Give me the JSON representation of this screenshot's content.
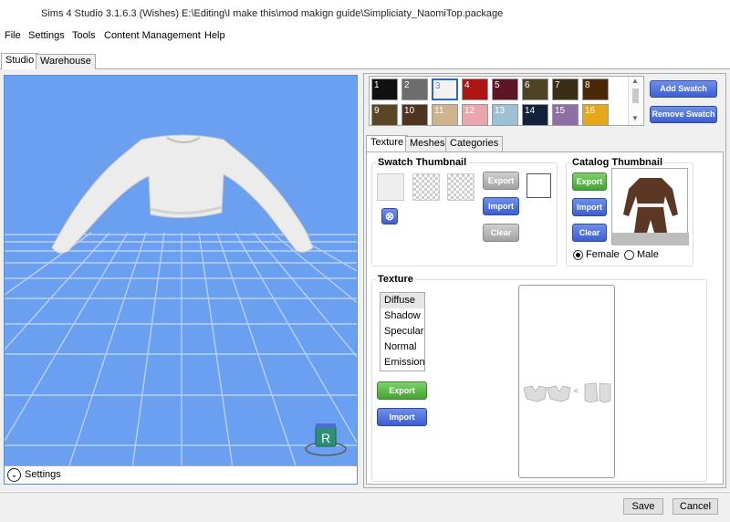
{
  "window": {
    "title": "Sims 4 Studio 3.1.6.3 (Wishes)  E:\\Editing\\I make this\\mod makign guide\\Simpliciaty_NaomiTop.package"
  },
  "menu": [
    "File",
    "Settings",
    "Tools",
    "Content Management",
    "Help"
  ],
  "main_tabs": [
    "Studio",
    "Warehouse"
  ],
  "viewport": {
    "settings_label": "Settings",
    "background_color": "#6b9ff0",
    "icon": "r-badge-icon"
  },
  "swatches": [
    {
      "n": "1",
      "color": "#111111"
    },
    {
      "n": "2",
      "color": "#6d6d6d"
    },
    {
      "n": "3",
      "color": "#f2f2f2",
      "selected": true
    },
    {
      "n": "4",
      "color": "#b01515"
    },
    {
      "n": "5",
      "color": "#5e1525"
    },
    {
      "n": "6",
      "color": "#4e4325"
    },
    {
      "n": "7",
      "color": "#3a2e16"
    },
    {
      "n": "8",
      "color": "#4a2706"
    },
    {
      "n": "9",
      "color": "#5a4526"
    },
    {
      "n": "10",
      "color": "#4d3521"
    },
    {
      "n": "11",
      "color": "#cdb38e"
    },
    {
      "n": "12",
      "color": "#e9a7ad"
    },
    {
      "n": "13",
      "color": "#9dc0d2"
    },
    {
      "n": "14",
      "color": "#12223a"
    },
    {
      "n": "15",
      "color": "#8e6fa3"
    },
    {
      "n": "16",
      "color": "#e6a818"
    }
  ],
  "swatch_buttons": {
    "add": "Add Swatch",
    "remove": "Remove Swatch"
  },
  "sub_tabs": [
    "Texture",
    "Meshes",
    "Categories"
  ],
  "swatch_thumbnail": {
    "label": "Swatch Thumbnail",
    "export": "Export",
    "import": "Import",
    "clear": "Clear"
  },
  "catalog_thumbnail": {
    "label": "Catalog Thumbnail",
    "export": "Export",
    "import": "Import",
    "clear": "Clear",
    "gender_options": [
      "Female",
      "Male"
    ],
    "selected_gender": "Female"
  },
  "texture": {
    "label": "Texture",
    "channels": [
      "Diffuse",
      "Shadow",
      "Specular",
      "Normal",
      "Emission"
    ],
    "selected_channel": "Diffuse",
    "export": "Export",
    "import": "Import"
  },
  "footer": {
    "save": "Save",
    "cancel": "Cancel"
  }
}
